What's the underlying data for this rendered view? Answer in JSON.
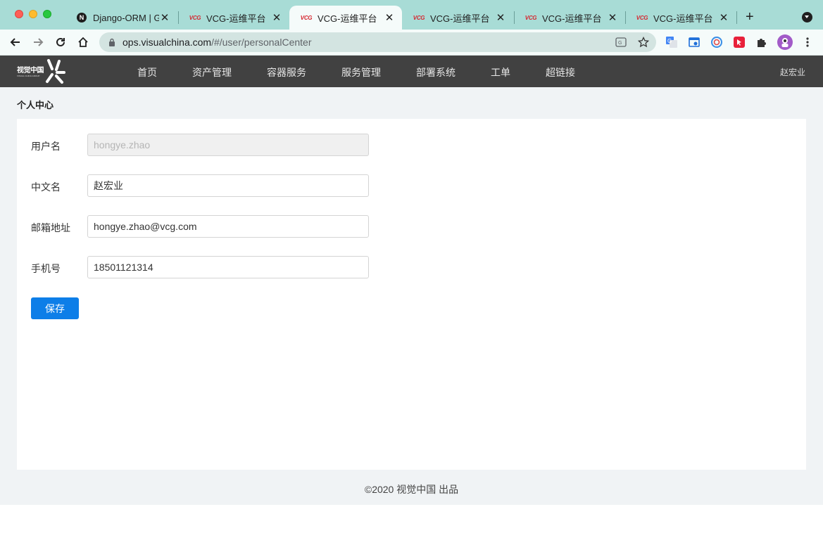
{
  "browser": {
    "tabs": [
      {
        "title": "Django-ORM | Ga",
        "favicon": "n-icon"
      },
      {
        "title": "VCG-运维平台",
        "favicon": "vcg-icon"
      },
      {
        "title": "VCG-运维平台",
        "favicon": "vcg-icon",
        "active": true
      },
      {
        "title": "VCG-运维平台",
        "favicon": "vcg-icon"
      },
      {
        "title": "VCG-运维平台",
        "favicon": "vcg-icon"
      },
      {
        "title": "VCG-运维平台",
        "favicon": "vcg-icon"
      }
    ],
    "url_host": "ops.visualchina.com",
    "url_path": "/#/user/personalCenter",
    "colors": {
      "tabstrip": "#a8dcd6",
      "toolbar": "#f5fbfa"
    }
  },
  "app": {
    "logo_text": "视觉中国",
    "logo_sub": "VISUAL CHINA GROUP",
    "nav": [
      "首页",
      "资产管理",
      "容器服务",
      "服务管理",
      "部署系统",
      "工单",
      "超链接"
    ],
    "user": "赵宏业"
  },
  "page": {
    "title": "个人中心",
    "form": {
      "username_label": "用户名",
      "username_value": "hongye.zhao",
      "cn_name_label": "中文名",
      "cn_name_value": "赵宏业",
      "email_label": "邮箱地址",
      "email_value": "hongye.zhao@vcg.com",
      "phone_label": "手机号",
      "phone_value": "18501121314",
      "save_label": "保存"
    },
    "footer": "©2020 视觉中国 出品"
  },
  "colors": {
    "header": "#414141",
    "primary": "#0d7ee8",
    "background": "#f0f3f5"
  }
}
